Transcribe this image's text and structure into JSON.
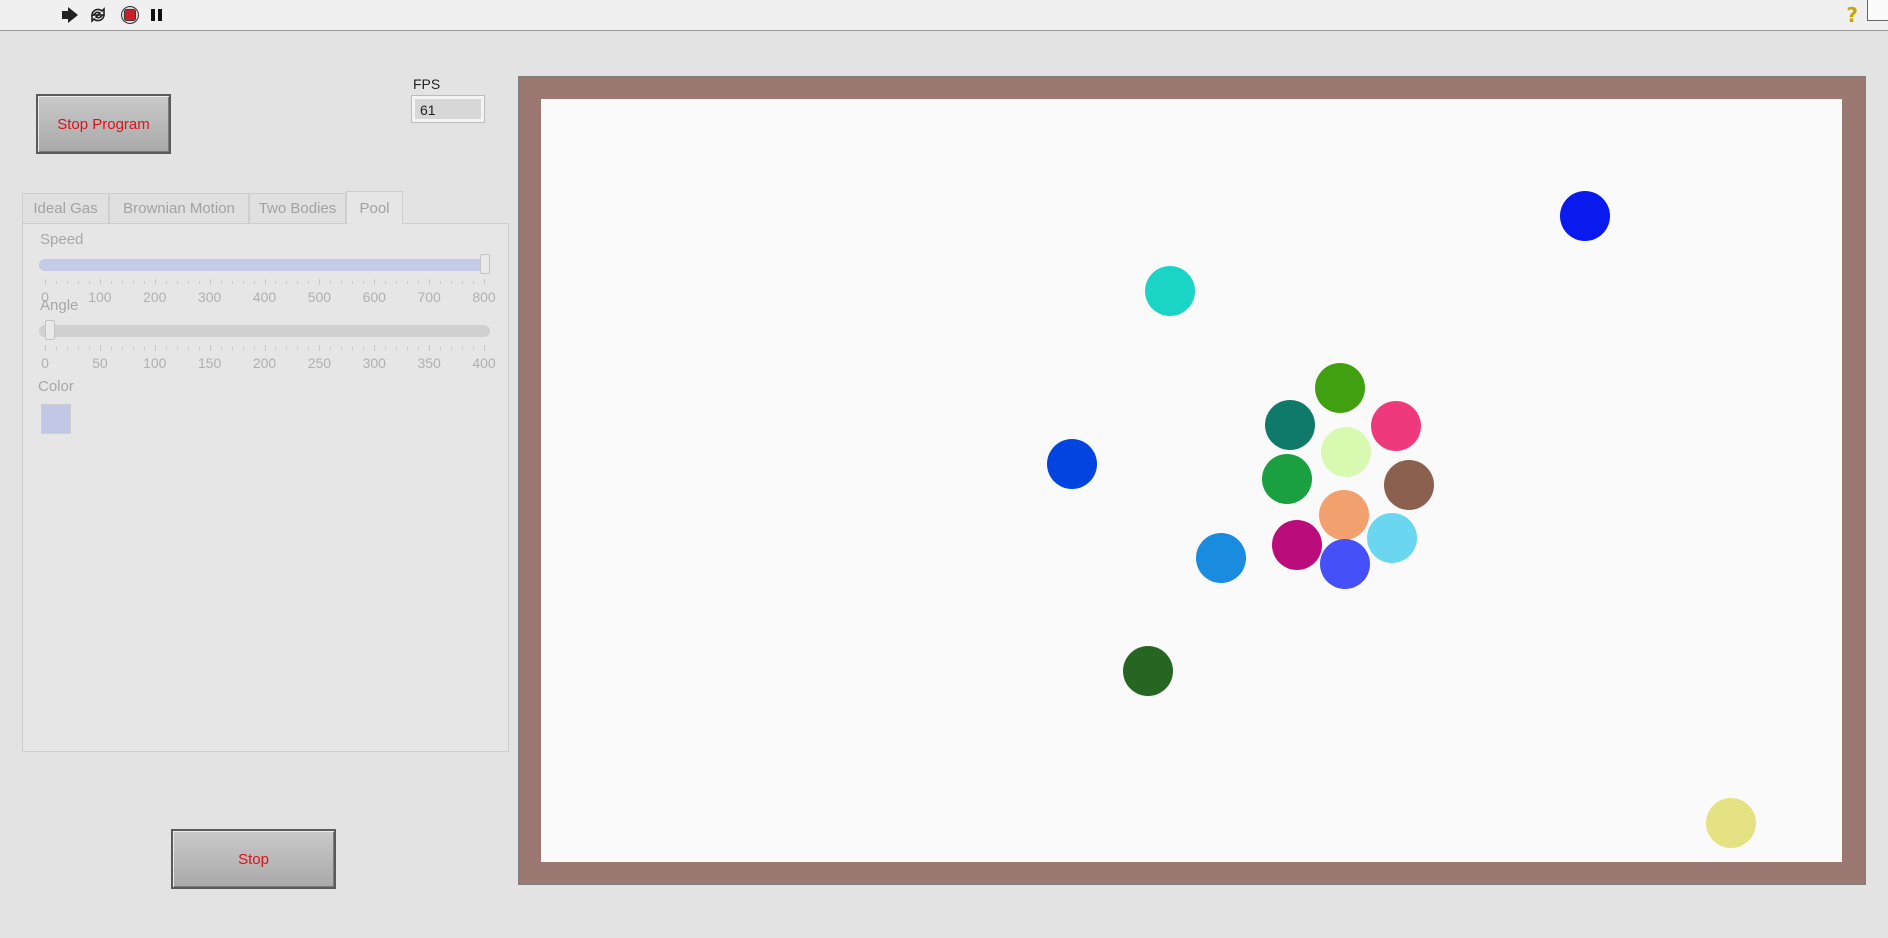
{
  "toolbar": {
    "icons": [
      "run-arrow-icon",
      "run-continuously-icon",
      "abort-stop-icon",
      "pause-icon",
      "help-icon"
    ]
  },
  "stop_program_label": "Stop Program",
  "fps": {
    "label": "FPS",
    "value": "61"
  },
  "tabs": [
    {
      "label": "Ideal Gas",
      "active": false
    },
    {
      "label": "Brownian Motion",
      "active": false
    },
    {
      "label": "Two Bodies",
      "active": false
    },
    {
      "label": "Pool",
      "active": true
    }
  ],
  "speed": {
    "label": "Speed",
    "value": 800,
    "min": 0,
    "max": 800,
    "ticks": [
      "0",
      "100",
      "200",
      "300",
      "400",
      "500",
      "600",
      "700",
      "800"
    ]
  },
  "angle": {
    "label": "Angle",
    "value": 0,
    "min": 0,
    "max": 400,
    "ticks": [
      "0",
      "50",
      "100",
      "150",
      "200",
      "250",
      "300",
      "350",
      "400"
    ]
  },
  "color_control": {
    "label": "Color",
    "value": "#c0c8e6"
  },
  "stop_label": "Stop",
  "pool": {
    "frame_color": "#9c7873",
    "felt_color": "#fafafa",
    "balls": [
      {
        "color": "#0a1aee"
      },
      {
        "color": "#1ad4c6"
      },
      {
        "color": "#40a010"
      },
      {
        "color": "#107a6a"
      },
      {
        "color": "#ee3a7c"
      },
      {
        "color": "#d8fab0"
      },
      {
        "color": "#0244e0"
      },
      {
        "color": "#1aa040"
      },
      {
        "color": "#8c604e"
      },
      {
        "color": "#f2a06e"
      },
      {
        "color": "#6ad6f0"
      },
      {
        "color": "#ba0c7a"
      },
      {
        "color": "#1a8ce0"
      },
      {
        "color": "#4650f8"
      },
      {
        "color": "#266622"
      },
      {
        "color": "#e4e282"
      }
    ]
  }
}
